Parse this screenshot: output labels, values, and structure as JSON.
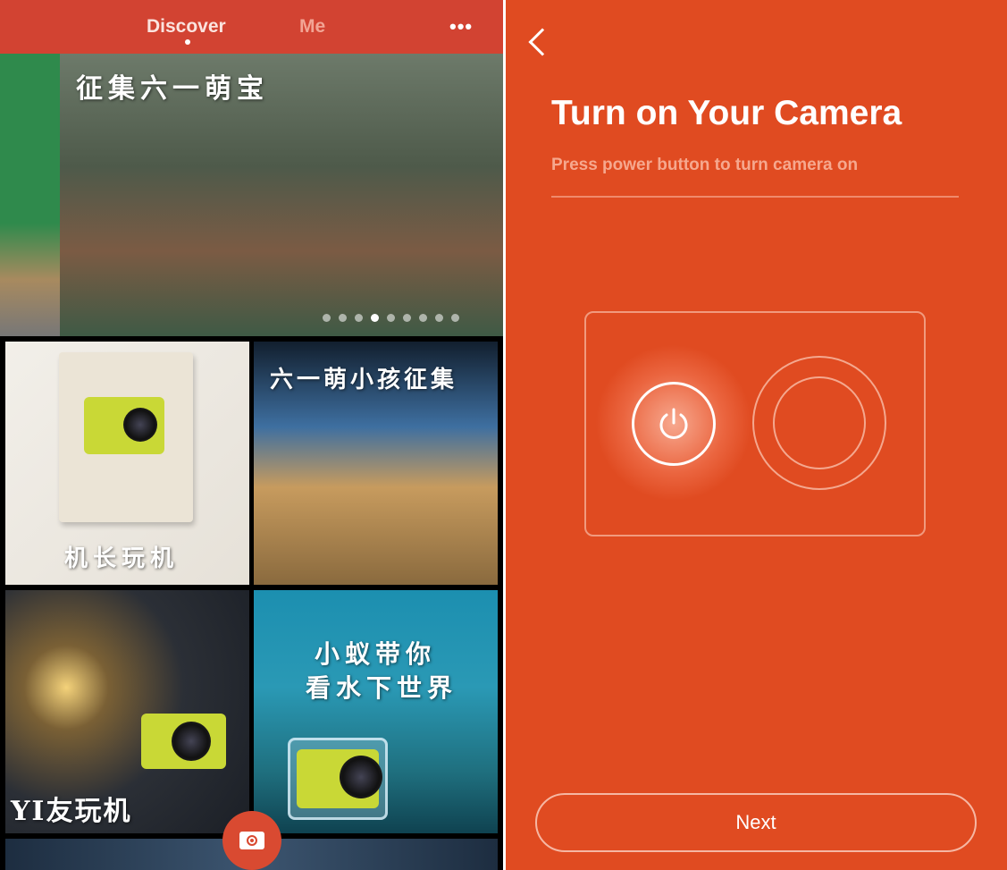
{
  "left_screen": {
    "header": {
      "tabs": [
        {
          "label": "Discover",
          "active": true
        },
        {
          "label": "Me",
          "active": false
        }
      ],
      "more_icon": "ellipsis-icon"
    },
    "banner": {
      "caption": "征集六一萌宝",
      "dots_total": 9,
      "dots_active_index": 3
    },
    "tiles": [
      {
        "caption": "机长玩机"
      },
      {
        "caption": "六一萌小孩征集"
      },
      {
        "caption": "YI友玩机"
      },
      {
        "caption_line1": "小蚁带你",
        "caption_line2": "看水下世界"
      }
    ],
    "camera_button_icon": "camera-icon",
    "accent": "#d24332"
  },
  "right_screen": {
    "back_icon": "chevron-left-icon",
    "title": "Turn on Your Camera",
    "subtitle": "Press power button to turn camera on",
    "power_icon": "power-icon",
    "next_label": "Next",
    "background": "#e04b21"
  }
}
